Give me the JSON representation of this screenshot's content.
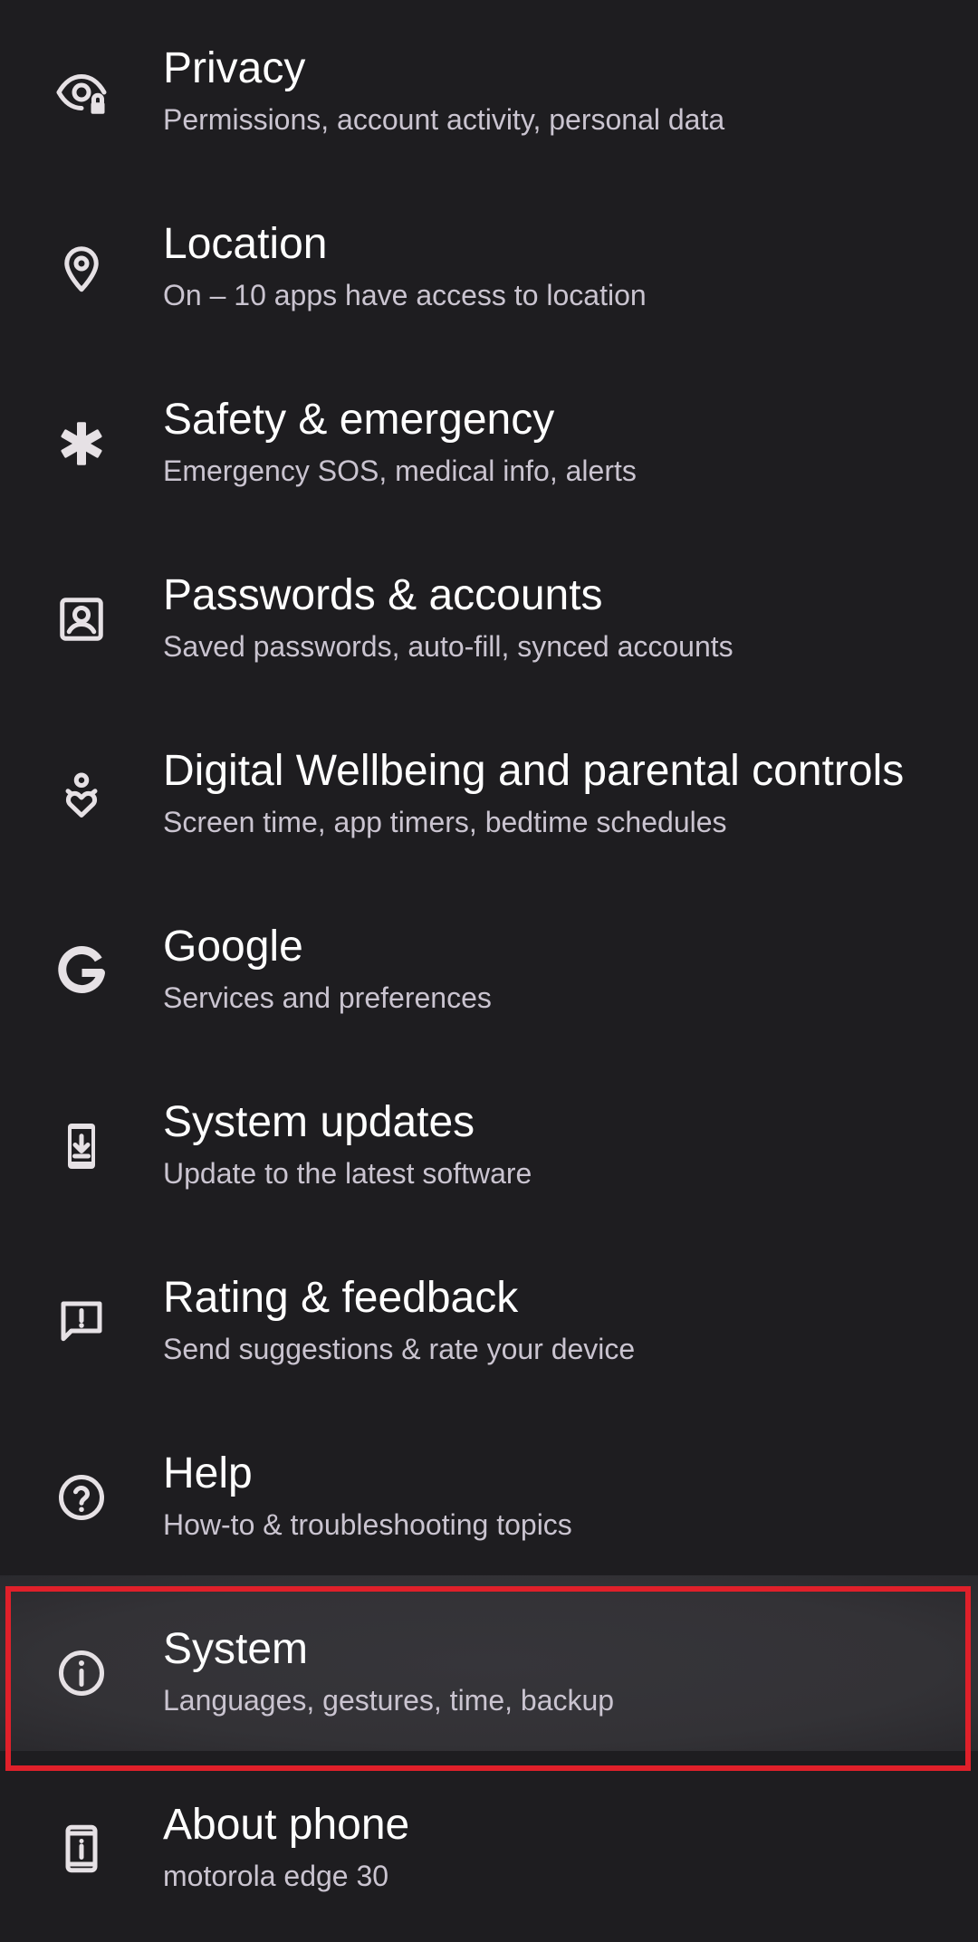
{
  "settings": {
    "items": [
      {
        "icon": "privacy-eye-lock-icon",
        "title": "Privacy",
        "subtitle": "Permissions, account activity, personal data"
      },
      {
        "icon": "location-pin-icon",
        "title": "Location",
        "subtitle": "On – 10 apps have access to location"
      },
      {
        "icon": "medical-asterisk-icon",
        "title": "Safety & emergency",
        "subtitle": "Emergency SOS, medical info, alerts"
      },
      {
        "icon": "account-box-icon",
        "title": "Passwords & accounts",
        "subtitle": "Saved passwords, auto-fill, synced accounts"
      },
      {
        "icon": "wellbeing-icon",
        "title": "Digital Wellbeing and parental controls",
        "subtitle": "Screen time, app timers, bedtime schedules"
      },
      {
        "icon": "google-g-icon",
        "title": "Google",
        "subtitle": "Services and preferences"
      },
      {
        "icon": "system-update-icon",
        "title": "System updates",
        "subtitle": "Update to the latest software"
      },
      {
        "icon": "feedback-icon",
        "title": "Rating & feedback",
        "subtitle": "Send suggestions & rate your device"
      },
      {
        "icon": "help-icon",
        "title": "Help",
        "subtitle": "How-to & troubleshooting topics"
      },
      {
        "icon": "info-icon",
        "title": "System",
        "subtitle": "Languages, gestures, time, backup"
      },
      {
        "icon": "phone-info-icon",
        "title": "About phone",
        "subtitle": "motorola edge 30"
      }
    ],
    "highlighted_item": "System"
  },
  "colors": {
    "background": "#1e1d20",
    "title": "#ffffff",
    "subtitle": "#cac4d0",
    "icon": "#e6e1e5",
    "highlight_background": "#333236",
    "highlight_border": "#e0202a"
  }
}
